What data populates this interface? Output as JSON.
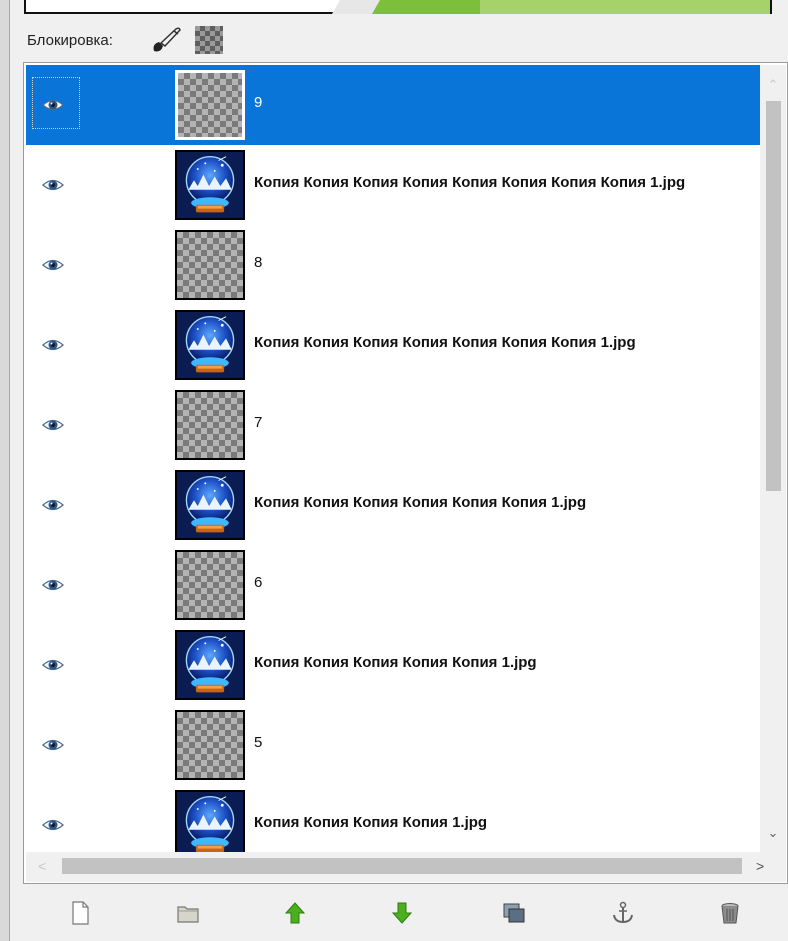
{
  "lock": {
    "label": "Блокировка:",
    "icons": [
      "paintbrush-lock-icon",
      "alpha-lock-icon"
    ]
  },
  "layers": [
    {
      "name": "9",
      "type": "transparent",
      "selected": true,
      "visible": true
    },
    {
      "name": "Копия Копия Копия Копия Копия Копия Копия Копия 1.jpg",
      "type": "globe",
      "selected": false,
      "visible": true
    },
    {
      "name": "8",
      "type": "transparent",
      "selected": false,
      "visible": true
    },
    {
      "name": "Копия Копия Копия Копия Копия Копия Копия 1.jpg",
      "type": "globe",
      "selected": false,
      "visible": true
    },
    {
      "name": "7",
      "type": "transparent",
      "selected": false,
      "visible": true
    },
    {
      "name": "Копия Копия Копия Копия Копия Копия 1.jpg",
      "type": "globe",
      "selected": false,
      "visible": true
    },
    {
      "name": "6",
      "type": "transparent",
      "selected": false,
      "visible": true
    },
    {
      "name": "Копия Копия Копия Копия Копия 1.jpg",
      "type": "globe",
      "selected": false,
      "visible": true
    },
    {
      "name": "5",
      "type": "transparent",
      "selected": false,
      "visible": true
    },
    {
      "name": "Копия Копия Копия Копия 1.jpg",
      "type": "globe",
      "selected": false,
      "visible": true
    }
  ],
  "toolbar": {
    "buttons": [
      "new-layer-icon",
      "new-layer-group-icon",
      "raise-layer-icon",
      "lower-layer-icon",
      "duplicate-layer-icon",
      "anchor-layer-icon",
      "delete-layer-icon"
    ]
  },
  "colors": {
    "selection": "#0a75d8",
    "raise_green": "#4caf1f"
  }
}
